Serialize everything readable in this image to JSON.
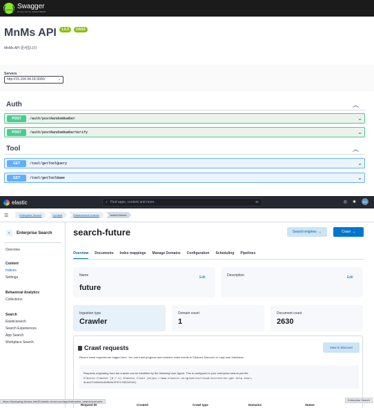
{
  "swagger": {
    "logo_name": "Swagger",
    "logo_by": "Supported by SMARTBEAR",
    "title": "MnMs API",
    "version": "1.0.0",
    "oas": "OAS3",
    "description": "MnMs API 문서입니다",
    "servers_label": "Servers",
    "server_selected": "http://15.164.94.18:3000/",
    "sections": [
      {
        "name": "Auth",
        "ops": [
          {
            "method": "POST",
            "path": "/auth/postRandomNumber"
          },
          {
            "method": "POST",
            "path": "/auth/postRandomNumberVerify"
          }
        ]
      },
      {
        "name": "Tool",
        "ops": [
          {
            "method": "GET",
            "path": "/tool/getToolQuery"
          },
          {
            "method": "GET",
            "path": "/tool/getToolName"
          }
        ]
      }
    ]
  },
  "elastic": {
    "brand": "elastic",
    "search_placeholder": "Find apps, content and more.",
    "search_shortcut": "⌘/",
    "avatar": "ES",
    "breadcrumbs": [
      "Enterprise Search",
      "Content",
      "Elasticsearch indices",
      "search-future"
    ],
    "sidebar": {
      "title": "Enterprise Search",
      "items": [
        {
          "label": "Overview",
          "group": true
        },
        {
          "label": "Content",
          "group": true
        },
        {
          "label": "Indices",
          "active": true
        },
        {
          "label": "Settings"
        },
        {
          "label": "Behavioral Analytics",
          "group": true
        },
        {
          "label": "Collections"
        },
        {
          "label": "Search",
          "group": true
        },
        {
          "label": "Elasticsearch"
        },
        {
          "label": "Search Experiences"
        },
        {
          "label": "App Search"
        },
        {
          "label": "Workplace Search"
        }
      ]
    },
    "page_title": "search-future",
    "search_engines_button": "Search engines",
    "crawl_button": "Crawl",
    "tabs": [
      "Overview",
      "Documents",
      "Index mappings",
      "Manage Domains",
      "Configuration",
      "Scheduling",
      "Pipelines"
    ],
    "name_card": {
      "label": "Name",
      "value": "future",
      "edit": "Edit"
    },
    "description_card": {
      "label": "Description",
      "edit": "Edit"
    },
    "ingestion_card": {
      "label": "Ingestion type",
      "value": "Crawler"
    },
    "domain_card": {
      "label": "Domain count",
      "value": "1"
    },
    "document_card": {
      "label": "Document count",
      "value": "2630"
    },
    "crawl_requests": {
      "title": "Crawl requests",
      "subtitle": "Recent crawl requests are logged here. You can track progress and examine crawl events in Kibana's Discover or Logs user interfaces",
      "discover_button": "View in Discover",
      "callout_line1": "Requests originating from the crawler can be identified by the following User Agent. This is configured in your enterprise-search.yml file.",
      "callout_line2": "Elastic-Crawler (8.7.1) Elastic Cloud (https://www.elastic.co/guide/en/cloud/current/ec-get-help.html;",
      "callout_line3": "9cae274d8e4b4b0b9e3f6f1f653dfe0)",
      "columns": [
        "Request ID",
        "Created",
        "Crawl type",
        "Domains",
        "Status"
      ]
    },
    "status_url": "https://deploying-kibana-tmh45.elastic-cloud.com/app/enterprise_search/overview",
    "tooltip": "Enterprise Search"
  }
}
